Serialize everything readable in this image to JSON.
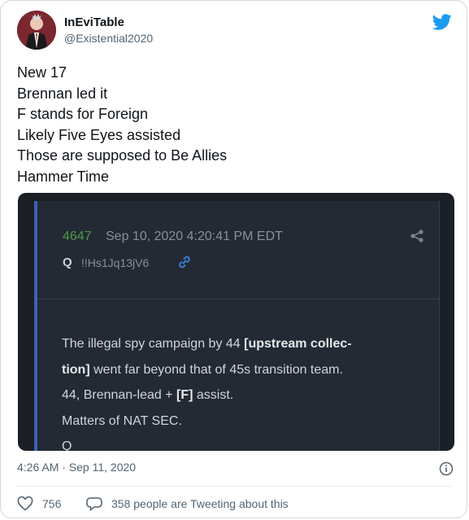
{
  "author": {
    "display_name": "InEviTable",
    "handle": "@Existential2020"
  },
  "tweet": {
    "lines": [
      "New 17",
      "Brennan led it",
      "F stands for Foreign",
      "Likely Five Eyes assisted",
      "Those are supposed to Be Allies",
      "Hammer Time"
    ]
  },
  "embed": {
    "post_number": "4647",
    "post_date": "Sep 10, 2020 4:20:41 PM EDT",
    "author": "Q",
    "tripcode": "!!Hs1Jq13jV6",
    "body": {
      "line1_a": "The illegal spy campaign by 44 ",
      "line1_b": "[upstream collec-",
      "line2_a": "tion]",
      "line2_b": " went far beyond that of 45s transition team.",
      "line3_a": "44, Brennan-lead + ",
      "line3_b": "[F]",
      "line3_c": " assist.",
      "line4": "Matters of NAT SEC.",
      "line5": "Q"
    }
  },
  "meta": {
    "timestamp": "4:26 AM · Sep 11, 2020"
  },
  "engagement": {
    "likes": "756",
    "replies_text": "358 people are Tweeting about this"
  },
  "colors": {
    "twitter_blue": "#1d9bf0",
    "embed_bg": "#1b1f26",
    "post_number_green": "#4a9a48",
    "link_blue": "#3a7bd5"
  },
  "icons": [
    "avatar",
    "twitter-bird-icon",
    "share-icon",
    "link-icon",
    "info-icon",
    "heart-icon",
    "speech-bubble-icon"
  ]
}
